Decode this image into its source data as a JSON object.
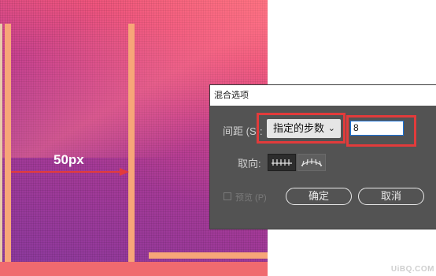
{
  "annotation": {
    "distance_label": "50px",
    "accent_color": "#e23b3b"
  },
  "dialog": {
    "title": "混合选项",
    "spacing": {
      "label": "间距 (S):",
      "selected_option": "指定的步数",
      "value": "8"
    },
    "orientation": {
      "label": "取向:",
      "options": [
        "对齐页面",
        "对齐路径"
      ]
    },
    "preview": {
      "label": "预览 (P)",
      "checked": false
    },
    "buttons": {
      "ok": "确定",
      "cancel": "取消"
    }
  },
  "watermark": {
    "text": "UiBQ.COM"
  }
}
